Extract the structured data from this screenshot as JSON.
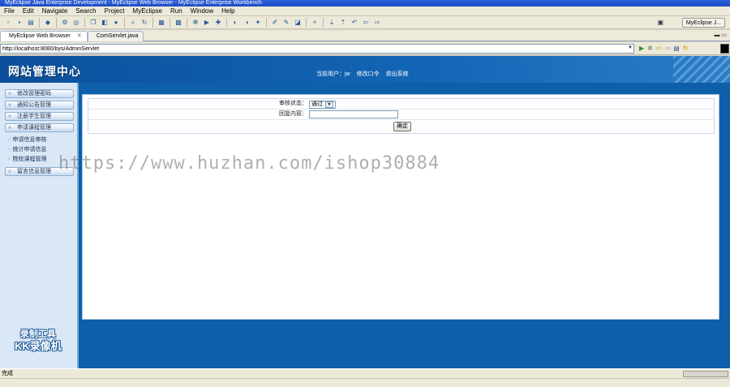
{
  "window": {
    "title": "MyEclipse Java Enterprise Development - MyEclipse Web Browser - MyEclipse Enterprise Workbench"
  },
  "menu": [
    "File",
    "Edit",
    "Navigate",
    "Search",
    "Project",
    "MyEclipse",
    "Run",
    "Window",
    "Help"
  ],
  "toolbar": {
    "perspective_label": "MyEclipse J..."
  },
  "tabs": [
    {
      "label": "MyEclipse Web Browser"
    },
    {
      "label": "ComServlet.java"
    }
  ],
  "address": {
    "url": "http://localhost:8080/bys/AdminServlet"
  },
  "page": {
    "site_title": "网站管理中心",
    "current_user_label": "当前用户：jw",
    "change_password": "修改口令",
    "logout": "退出系统",
    "sidebar": {
      "items": [
        {
          "label": "修改管理密码"
        },
        {
          "label": "通知公告管理"
        },
        {
          "label": "注册学生管理"
        },
        {
          "label": "申请课程管理"
        }
      ],
      "sub_items": [
        {
          "label": "申请信息审核"
        },
        {
          "label": "统计申请信息"
        },
        {
          "label": "院校课程管理"
        }
      ],
      "last_item": {
        "label": "留言信息管理"
      }
    },
    "form": {
      "audit_label": "审核状态：",
      "audit_value": "通过",
      "reply_label": "回复内容：",
      "submit_label": "确定"
    },
    "recorder_badge": {
      "line1": "录制工具",
      "line2": "KK录像机"
    },
    "watermark": "https://www.huzhan.com/ishop30884"
  },
  "status": {
    "text": "完成"
  }
}
